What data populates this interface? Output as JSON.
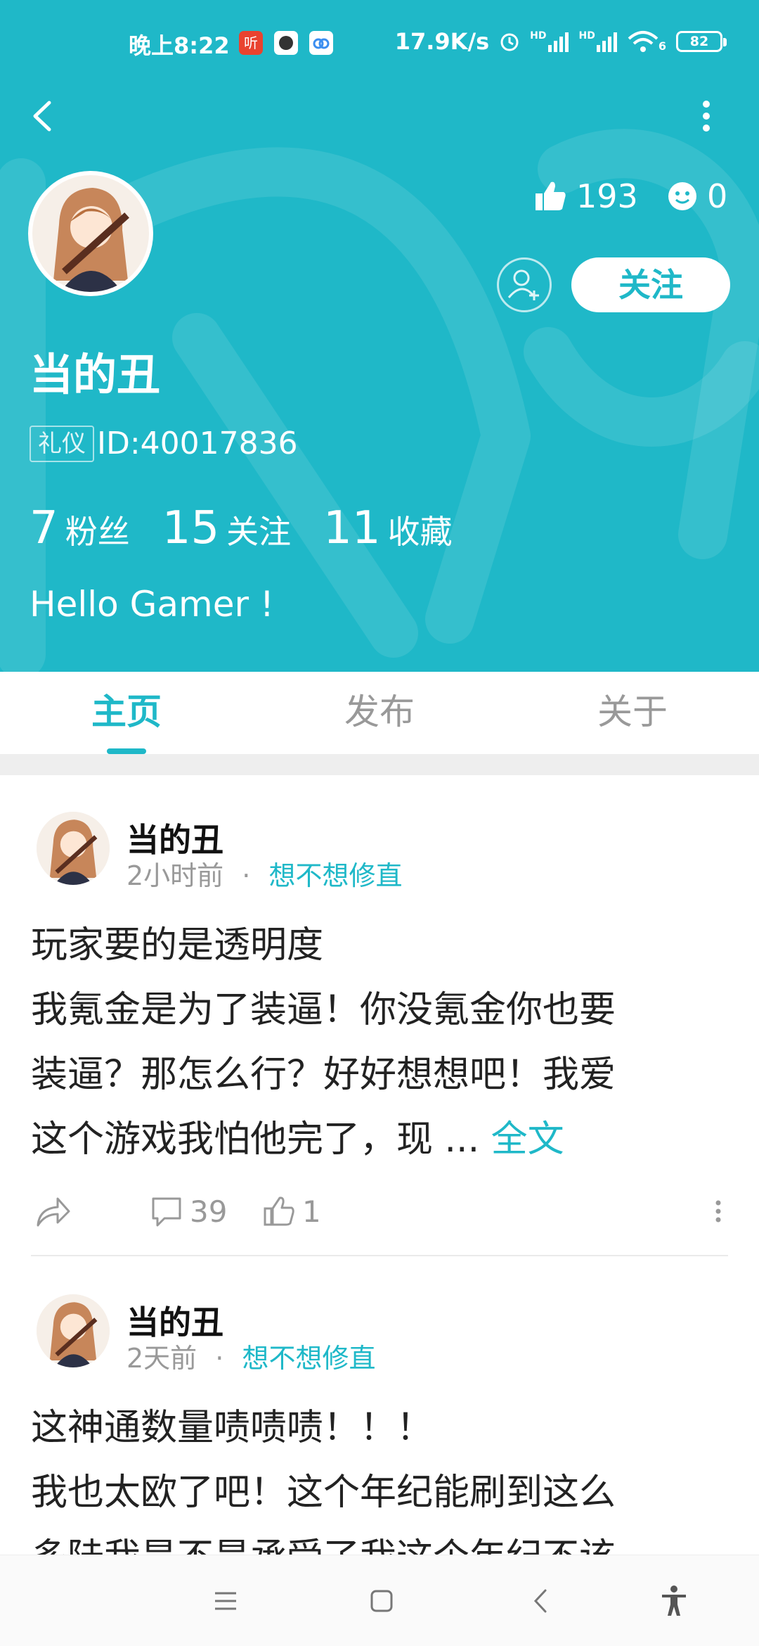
{
  "status_bar": {
    "time": "晚上8:22",
    "app_icon_1": "听",
    "net_speed": "17.9K/s",
    "signal_1": "HD",
    "signal_2": "HD",
    "wifi": "6",
    "battery": "82"
  },
  "profile": {
    "likes": "193",
    "smiles": "0",
    "follow_label": "关注",
    "username": "当的丑",
    "badge": "礼仪",
    "user_id": "ID:40017836",
    "stats": [
      {
        "num": "7",
        "label": "粉丝"
      },
      {
        "num": "15",
        "label": "关注"
      },
      {
        "num": "11",
        "label": "收藏"
      }
    ],
    "bio": "Hello Gamer !"
  },
  "tabs": [
    {
      "label": "主页",
      "active": true
    },
    {
      "label": "发布",
      "active": false
    },
    {
      "label": "关于",
      "active": false
    }
  ],
  "posts": [
    {
      "author": "当的丑",
      "time": "2小时前",
      "dot": "·",
      "topic": "想不想修直",
      "lines": [
        "玩家要的是透明度",
        "我氪金是为了装逼！你没氪金你也要",
        "装逼？那怎么行？好好想想吧！我爱",
        "这个游戏我怕他完了，现 ..."
      ],
      "more": "全文",
      "comments": "39",
      "likes": "1"
    },
    {
      "author": "当的丑",
      "time": "2天前",
      "dot": "·",
      "topic": "想不想修直",
      "lines": [
        "这神通数量啧啧啧！！！",
        "我也太欧了吧！这个年纪能刷到这么",
        "多陆我是不是承受了我这个年纪不该"
      ]
    }
  ],
  "colors": {
    "accent": "#1fb8c8",
    "header_bg": "#1fb8c8"
  }
}
